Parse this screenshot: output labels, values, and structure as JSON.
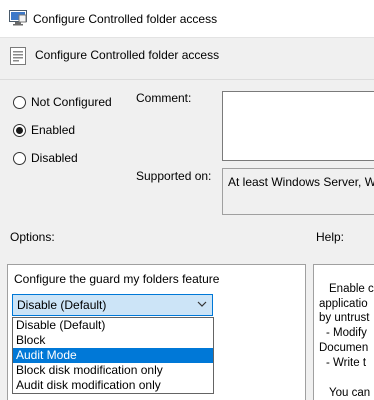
{
  "window": {
    "title": "Configure Controlled folder access"
  },
  "header": {
    "heading": "Configure Controlled folder access"
  },
  "state": {
    "options": [
      {
        "label": "Not Configured",
        "checked": false
      },
      {
        "label": "Enabled",
        "checked": true
      },
      {
        "label": "Disabled",
        "checked": false
      }
    ]
  },
  "comment": {
    "label": "Comment:",
    "value": ""
  },
  "supported": {
    "label": "Supported on:",
    "value": "At least Windows Server, Wi"
  },
  "options_section": {
    "label": "Options:"
  },
  "help_section": {
    "label": "Help:"
  },
  "guard": {
    "label": "Configure the guard my folders feature",
    "selected": "Disable (Default)",
    "items": [
      {
        "label": "Disable (Default)",
        "highlighted": false
      },
      {
        "label": "Block",
        "highlighted": false
      },
      {
        "label": "Audit Mode",
        "highlighted": true
      },
      {
        "label": "Block disk modification only",
        "highlighted": false
      },
      {
        "label": "Audit disk modification only",
        "highlighted": false
      }
    ]
  },
  "help": {
    "lines": [
      "Enable c",
      "applicatio",
      "by untrust",
      "- Modify",
      "Documen",
      "- Write t",
      "You can"
    ]
  },
  "colors": {
    "accent": "#0078d7",
    "combo_bg": "#cce4f7",
    "dialog_bg": "#f0f0f0"
  }
}
